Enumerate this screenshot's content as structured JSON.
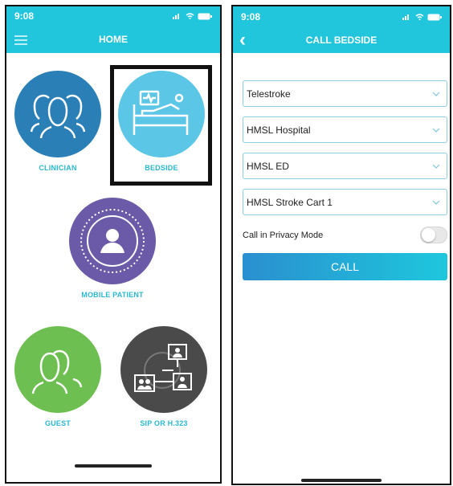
{
  "colors": {
    "accent": "#21c6dc",
    "clinician": "#2a7fb6",
    "bedside": "#5cc6e6",
    "mobile_patient": "#6a5aa7",
    "guest": "#6cbf50",
    "sip": "#4a4a4a",
    "label": "#2bb7d1",
    "call_button": "#1ec7dd"
  },
  "left_screen": {
    "status": {
      "time": "9:08"
    },
    "nav": {
      "title": "HOME",
      "menu_icon": "hamburger-icon"
    },
    "tiles": [
      {
        "label": "CLINICIAN",
        "icon": "users-icon"
      },
      {
        "label": "BEDSIDE",
        "icon": "hospital-bed-icon"
      },
      {
        "label": "MOBILE PATIENT",
        "icon": "patient-icon"
      },
      {
        "label": "GUEST",
        "icon": "users-icon"
      },
      {
        "label": "SIP OR H.323",
        "icon": "network-icon"
      }
    ]
  },
  "right_screen": {
    "status": {
      "time": "9:08"
    },
    "nav": {
      "title": "CALL BEDSIDE",
      "back_icon": "back-chevron-icon"
    },
    "dropdowns": [
      {
        "value": "Telestroke"
      },
      {
        "value": "HMSL Hospital"
      },
      {
        "value": "HMSL ED"
      },
      {
        "value": "HMSL Stroke Cart 1"
      }
    ],
    "privacy": {
      "label": "Call in Privacy Mode",
      "enabled": false
    },
    "call_button": {
      "label": "CALL"
    }
  }
}
